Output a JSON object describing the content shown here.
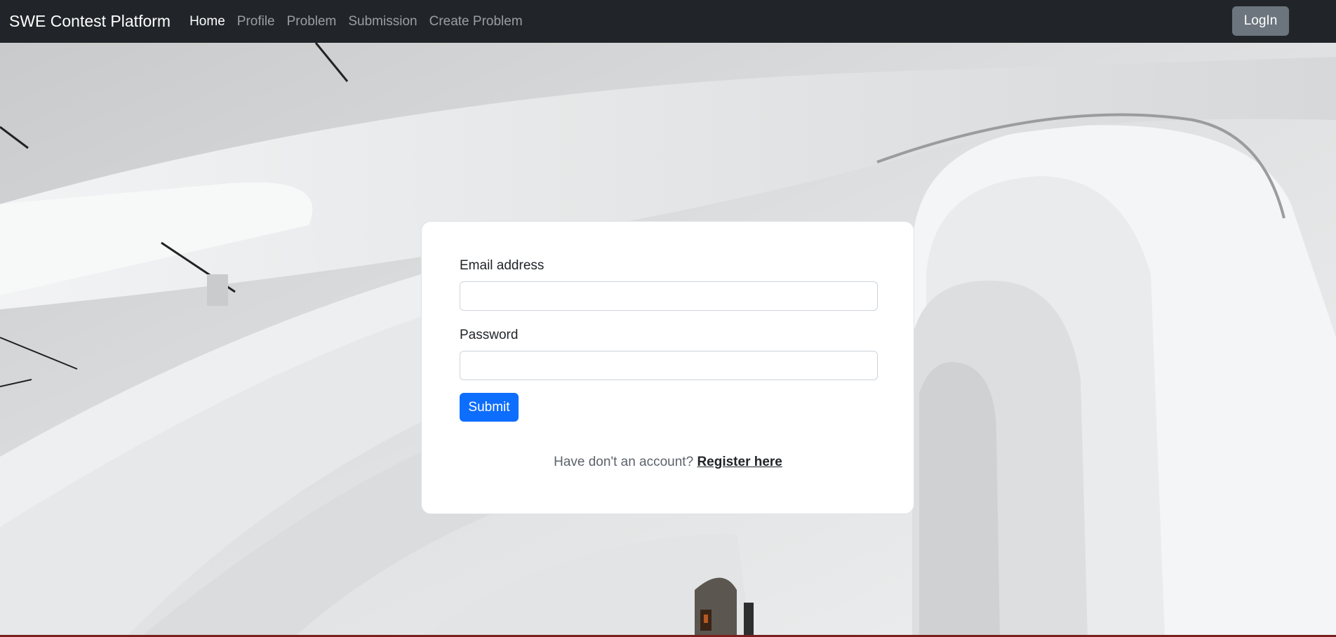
{
  "navbar": {
    "brand": "SWE Contest Platform",
    "links": [
      {
        "label": "Home",
        "active": true
      },
      {
        "label": "Profile",
        "active": false
      },
      {
        "label": "Problem",
        "active": false
      },
      {
        "label": "Submission",
        "active": false
      },
      {
        "label": "Create Problem",
        "active": false
      }
    ],
    "login_label": "LogIn"
  },
  "form": {
    "email_label": "Email address",
    "email_value": "",
    "password_label": "Password",
    "password_value": "",
    "submit_label": "Submit",
    "register_prompt": "Have don't an account?",
    "register_link": "Register here"
  },
  "colors": {
    "navbar_bg": "#212529",
    "primary": "#0d6efd",
    "secondary": "#6c757d"
  }
}
